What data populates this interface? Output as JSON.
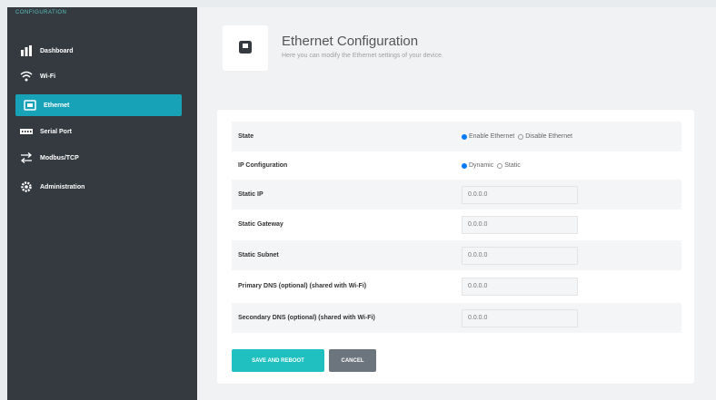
{
  "sidebar": {
    "header": "CONFIGURATION",
    "items": [
      {
        "label": "Dashboard",
        "icon": "dashboard-icon",
        "active": false
      },
      {
        "label": "Wi-Fi",
        "icon": "wifi-icon",
        "active": false
      },
      {
        "label": "Ethernet",
        "icon": "ethernet-icon",
        "active": true
      },
      {
        "label": "Serial Port",
        "icon": "serial-port-icon",
        "active": false
      },
      {
        "label": "Modbus/TCP",
        "icon": "modbus-icon",
        "active": false
      },
      {
        "label": "Administration",
        "icon": "administration-icon",
        "active": false
      }
    ]
  },
  "header": {
    "title": "Ethernet Configuration",
    "subtitle": "Here you can modify the Ethernet settings of your device."
  },
  "form": {
    "state": {
      "label": "State",
      "options": [
        "Enable Ethernet",
        "Disable Ethernet"
      ],
      "selected": "Enable Ethernet"
    },
    "ip_configuration": {
      "label": "IP Configuration",
      "options": [
        "Dynamic",
        "Static"
      ],
      "selected": "Dynamic"
    },
    "static_ip": {
      "label": "Static IP",
      "placeholder": "0.0.0.0"
    },
    "static_gateway": {
      "label": "Static Gateway",
      "placeholder": "0.0.0.0"
    },
    "static_subnet": {
      "label": "Static Subnet",
      "placeholder": "0.0.0.0"
    },
    "primary_dns": {
      "label": "Primary DNS (optional) (shared with Wi-Fi)",
      "placeholder": "0.0.0.0"
    },
    "secondary_dns": {
      "label": "Secondary DNS (optional) (shared with Wi-Fi)",
      "placeholder": "0.0.0.0"
    }
  },
  "buttons": {
    "save": "SAVE AND REBOOT",
    "cancel": "CANCEL"
  },
  "colors": {
    "sidebar_bg": "#343a40",
    "active_item": "#17a2b8",
    "save_button": "#20c0c0",
    "cancel_button": "#6c757d",
    "radio_selected": "#007bff"
  }
}
